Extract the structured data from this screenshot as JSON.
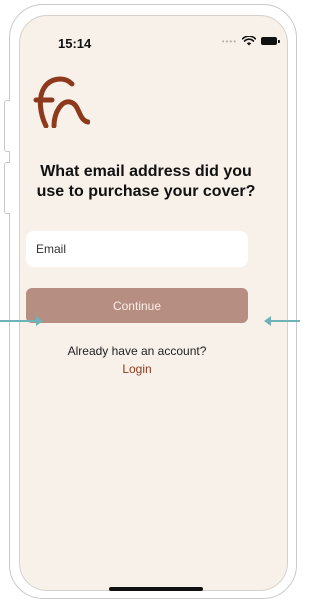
{
  "status_bar": {
    "time": "15:14",
    "signal_icon": "signal-dots-icon",
    "wifi_icon": "wifi-icon",
    "battery_icon": "battery-icon"
  },
  "logo": {
    "icon": "brand-logo-icon",
    "color": "#8c3a1b"
  },
  "question": "What email address did you use to purchase your cover?",
  "email_input": {
    "placeholder": "Email",
    "value": ""
  },
  "continue_button": {
    "label": "Continue",
    "color": "#b78f82"
  },
  "account_prompt": "Already have an account?",
  "login_link": {
    "label": "Login",
    "color": "#8c3a1b"
  },
  "background_color": "#f8f1ea"
}
